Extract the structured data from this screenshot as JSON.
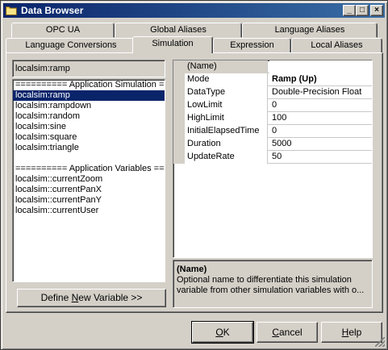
{
  "window": {
    "title": "Data Browser",
    "minimize_glyph": "_",
    "maximize_glyph": "□",
    "close_glyph": "×"
  },
  "tabs": {
    "row1": [
      "OPC UA",
      "Global Aliases",
      "Language Aliases"
    ],
    "row2": [
      "Language Conversions",
      "Simulation",
      "Expression",
      "Local Aliases"
    ],
    "active": "Simulation"
  },
  "name_field": {
    "value": "localsim:ramp"
  },
  "variable_list": [
    {
      "text": "========== Application Simulation ==",
      "selected": false
    },
    {
      "text": "localsim:ramp",
      "selected": true
    },
    {
      "text": "localsim:rampdown",
      "selected": false
    },
    {
      "text": "localsim:random",
      "selected": false
    },
    {
      "text": "localsim:sine",
      "selected": false
    },
    {
      "text": "localsim:square",
      "selected": false
    },
    {
      "text": "localsim:triangle",
      "selected": false
    },
    {
      "text": "",
      "selected": false
    },
    {
      "text": "========== Application Variables ===",
      "selected": false
    },
    {
      "text": "localsim::currentZoom",
      "selected": false
    },
    {
      "text": "localsim::currentPanX",
      "selected": false
    },
    {
      "text": "localsim::currentPanY",
      "selected": false
    },
    {
      "text": "localsim::currentUser",
      "selected": false
    }
  ],
  "define_button": {
    "pre": "Define ",
    "accel": "N",
    "post": "ew Variable >>"
  },
  "properties": [
    {
      "name": "(Name)",
      "value": ""
    },
    {
      "name": "Mode",
      "value": "Ramp (Up)"
    },
    {
      "name": "DataType",
      "value": "Double-Precision Float"
    },
    {
      "name": "LowLimit",
      "value": "0"
    },
    {
      "name": "HighLimit",
      "value": "100"
    },
    {
      "name": "InitialElapsedTime",
      "value": "0"
    },
    {
      "name": "Duration",
      "value": "5000"
    },
    {
      "name": "UpdateRate",
      "value": "50"
    }
  ],
  "description": {
    "title": "(Name)",
    "body": "Optional name to differentiate this simulation variable from other simulation variables with o..."
  },
  "buttons": {
    "ok": {
      "accel": "O",
      "rest": "K"
    },
    "cancel": {
      "pre": "",
      "accel": "C",
      "rest": "ancel"
    },
    "help": {
      "accel": "H",
      "rest": "elp"
    }
  },
  "colors": {
    "title_start": "#0a246a",
    "title_end": "#3a6ea5",
    "face": "#d4d0c8",
    "selection": "#0a246a"
  }
}
